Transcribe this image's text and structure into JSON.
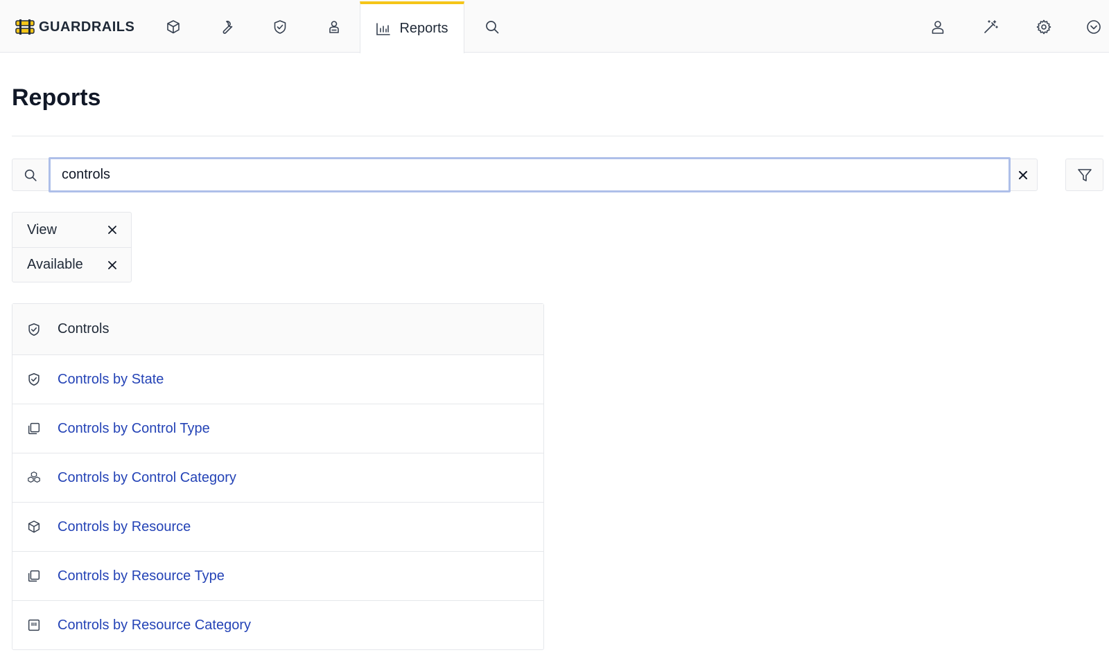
{
  "brand": {
    "name": "GUARDRAILS"
  },
  "nav": {
    "icons": [
      "cube-icon",
      "wrench-icon",
      "shield-check-icon",
      "worker-icon"
    ],
    "active_tab": {
      "label": "Reports",
      "icon": "bar-chart-icon"
    },
    "search_icon": "search-icon",
    "right_icons": [
      "user-icon",
      "magic-wand-icon",
      "gear-icon",
      "chevron-circle-down-icon"
    ]
  },
  "page": {
    "title": "Reports"
  },
  "search": {
    "value": "controls",
    "clear_icon": "close-icon",
    "filter_icon": "filter-icon"
  },
  "filters": [
    {
      "label": "View"
    },
    {
      "label": "Available"
    }
  ],
  "results": {
    "header": {
      "label": "Controls",
      "icon": "shield-check-icon"
    },
    "items": [
      {
        "label": "Controls by State",
        "icon": "shield-check-icon"
      },
      {
        "label": "Controls by Control Type",
        "icon": "copy-icon"
      },
      {
        "label": "Controls by Control Category",
        "icon": "cubes-icon"
      },
      {
        "label": "Controls by Resource",
        "icon": "cube-icon"
      },
      {
        "label": "Controls by Resource Type",
        "icon": "copy-icon"
      },
      {
        "label": "Controls by Resource Category",
        "icon": "category-box-icon"
      }
    ]
  },
  "colors": {
    "accent": "#f5c518",
    "link": "#2443b6",
    "focus_border": "#aebfe9"
  }
}
